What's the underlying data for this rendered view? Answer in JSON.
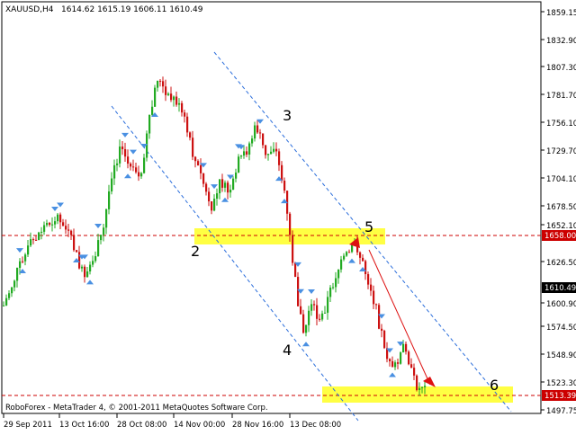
{
  "header": {
    "symbol_timeframe": "XAUUSD,H4",
    "ohlc": "1614.62 1615.19 1606.11 1610.49"
  },
  "watermark": "RoboForex - MetaTrader 4, © 2001-2011 MetaQuotes Software Corp.",
  "price_axis": {
    "ticks": [
      "1859.15",
      "1832.90",
      "1807.30",
      "1781.70",
      "1756.10",
      "1729.70",
      "1704.10",
      "1678.50",
      "1652.10",
      "1626.50",
      "1600.90",
      "1574.50",
      "1548.90",
      "1523.30",
      "1497.75"
    ],
    "level_label_1658": "1658.00",
    "last_price_label": "1610.49",
    "level_label_1513": "1513.39"
  },
  "time_axis": {
    "labels": [
      "29 Sep 2011",
      "13 Oct 16:00",
      "28 Oct 08:00",
      "14 Nov 00:00",
      "28 Nov 16:00",
      "13 Dec 08:00"
    ]
  },
  "wave_labels": {
    "w2": "2",
    "w3": "3",
    "w4": "4",
    "w5": "5",
    "w6": "6"
  },
  "colors": {
    "background": "#ffffff",
    "bull_candle": "#22aa22",
    "bear_candle": "#cc1111",
    "channel_lines": "#2a6ddb",
    "fractal_arrows": "#4a90e2",
    "support_zone": "#ffff33",
    "level_line": "#cc0000",
    "forecast_arrow": "#dd1111",
    "level_label_bg": "#cc0000",
    "last_price_bg": "#000000"
  }
}
